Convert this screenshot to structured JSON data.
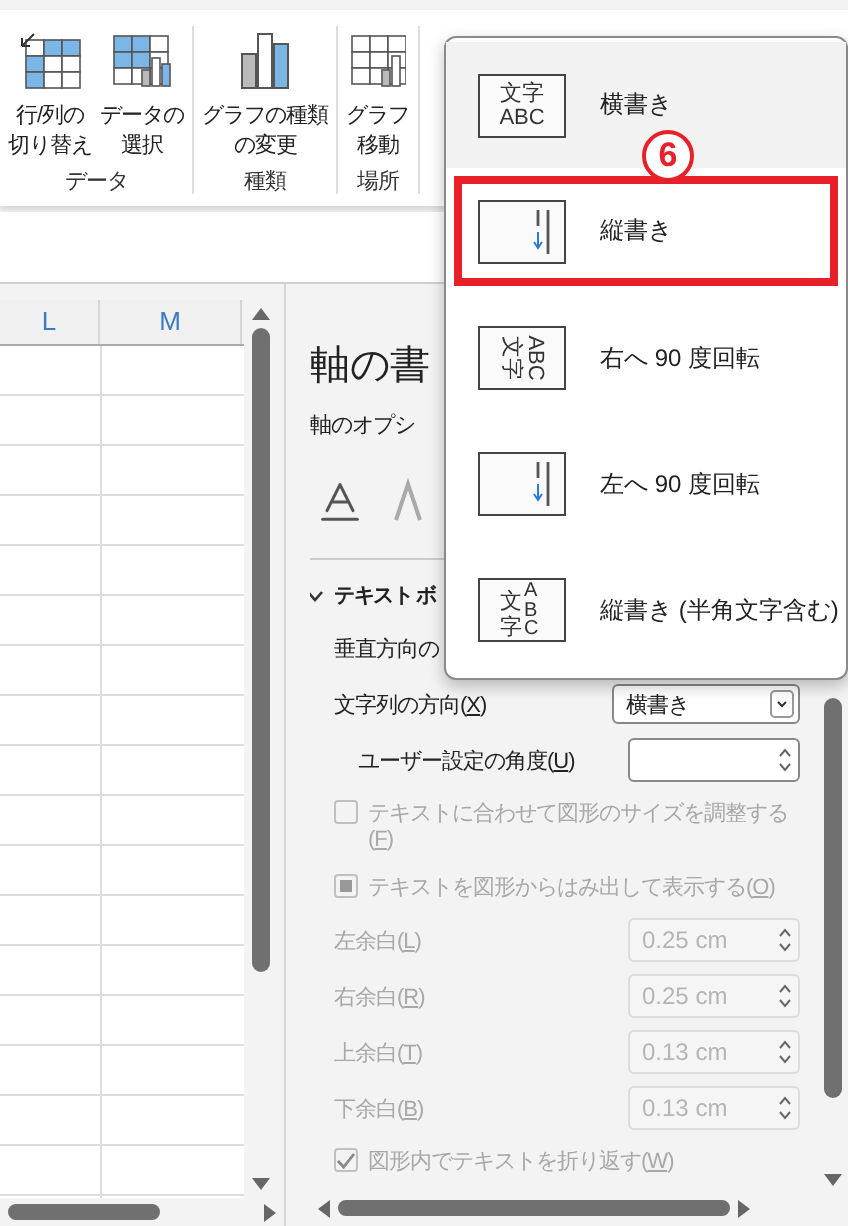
{
  "ribbon": {
    "groups": [
      {
        "label": "データ",
        "buttons": [
          {
            "kind": "switch",
            "lines": [
              "行/列の",
              "切り替え"
            ]
          },
          {
            "kind": "select_data",
            "lines": [
              "データの",
              "選択"
            ]
          }
        ]
      },
      {
        "label": "種類",
        "buttons": [
          {
            "kind": "chart_type",
            "lines": [
              "グラフの種類",
              "の変更"
            ]
          }
        ]
      },
      {
        "label": "場所",
        "buttons": [
          {
            "kind": "move",
            "lines": [
              "グラフ",
              "移動"
            ]
          }
        ]
      }
    ]
  },
  "sheet": {
    "columns": [
      "L",
      "M"
    ]
  },
  "pane": {
    "title": "軸の書",
    "tab": "軸のオプシ",
    "section": {
      "title": "テキスト ボ",
      "expanded": true
    },
    "rows": [
      {
        "kind": "label",
        "before": "垂直方向の"
      },
      {
        "kind": "select",
        "before": "文字列の方向(",
        "key": "X",
        "after": ")",
        "value": "横書き",
        "disabled": false
      },
      {
        "kind": "spin",
        "indented": true,
        "before": "ユーザー設定の角度(",
        "key": "U",
        "after": ")",
        "disabled": false
      },
      {
        "kind": "checkbox",
        "before": "テキストに合わせて図形のサイズを調整する(",
        "key": "F",
        "after": ")",
        "checked": false,
        "disabled": true
      },
      {
        "kind": "option",
        "before": "テキストを図形からはみ出して表示する(",
        "key": "O",
        "after": ")",
        "checked": true,
        "disabled": true
      },
      {
        "kind": "spin",
        "indented": false,
        "before": "左余白(",
        "key": "L",
        "after": ")",
        "value": "0.25 cm",
        "disabled": true
      },
      {
        "kind": "spin",
        "indented": false,
        "before": "右余白(",
        "key": "R",
        "after": ")",
        "value": "0.25 cm",
        "disabled": true
      },
      {
        "kind": "spin",
        "indented": false,
        "before": "上余白(",
        "key": "T",
        "after": ")",
        "value": "0.13 cm",
        "disabled": true
      },
      {
        "kind": "spin",
        "indented": false,
        "before": "下余白(",
        "key": "B",
        "after": ")",
        "value": "0.13 cm",
        "disabled": true
      },
      {
        "kind": "checkbox",
        "before": "図形内でテキストを折り返す(",
        "key": "W",
        "after": ")",
        "checked": true,
        "disabled": true
      }
    ]
  },
  "menu": {
    "annotation": "6",
    "items": [
      {
        "label": "横書き",
        "icon": {
          "kind": "horizontal",
          "lines": [
            "文字",
            "ABC"
          ]
        },
        "selected": true,
        "highlighted": false
      },
      {
        "label": "縦書き",
        "icon": {
          "kind": "vertical"
        },
        "selected": false,
        "highlighted": true
      },
      {
        "label": "右へ 90 度回転",
        "icon": {
          "kind": "rotate_right",
          "lines": [
            "文字",
            "ABC"
          ]
        },
        "selected": false,
        "highlighted": false
      },
      {
        "label": "左へ 90 度回転",
        "icon": {
          "kind": "vertical"
        },
        "selected": false,
        "highlighted": false
      },
      {
        "label": "縦書き (半角文字含む)",
        "icon": {
          "kind": "stacked",
          "lines": [
            "文字",
            "ABC"
          ]
        },
        "selected": false,
        "highlighted": false
      }
    ]
  }
}
